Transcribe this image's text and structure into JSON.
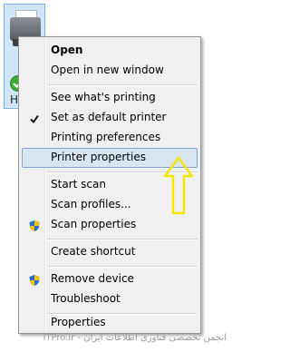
{
  "desktop": {
    "printer_label": "H"
  },
  "menu": {
    "items": [
      {
        "label": "Open"
      },
      {
        "label": "Open in new window"
      },
      {
        "label": "See what's printing"
      },
      {
        "label": "Set as default printer"
      },
      {
        "label": "Printing preferences"
      },
      {
        "label": "Printer properties"
      },
      {
        "label": "Start scan"
      },
      {
        "label": "Scan profiles..."
      },
      {
        "label": "Scan properties"
      },
      {
        "label": "Create shortcut"
      },
      {
        "label": "Remove device"
      },
      {
        "label": "Troubleshoot"
      },
      {
        "label": "Properties"
      }
    ],
    "checked_item": "Set as default printer",
    "highlighted_item": "Printer properties"
  },
  "annotation": {
    "arrow_color": "#f5e800",
    "arrow_icon": "up-arrow-icon"
  },
  "watermark": {
    "text": "ITPro.ir - انجمن تخصصی فناوری اطلاعات ایران"
  },
  "colors": {
    "menu_background": "#f0f0f0",
    "highlight_background": "#d8e6f2",
    "highlight_border": "#7da2ce",
    "selection_tile": "#cfe6fb"
  }
}
